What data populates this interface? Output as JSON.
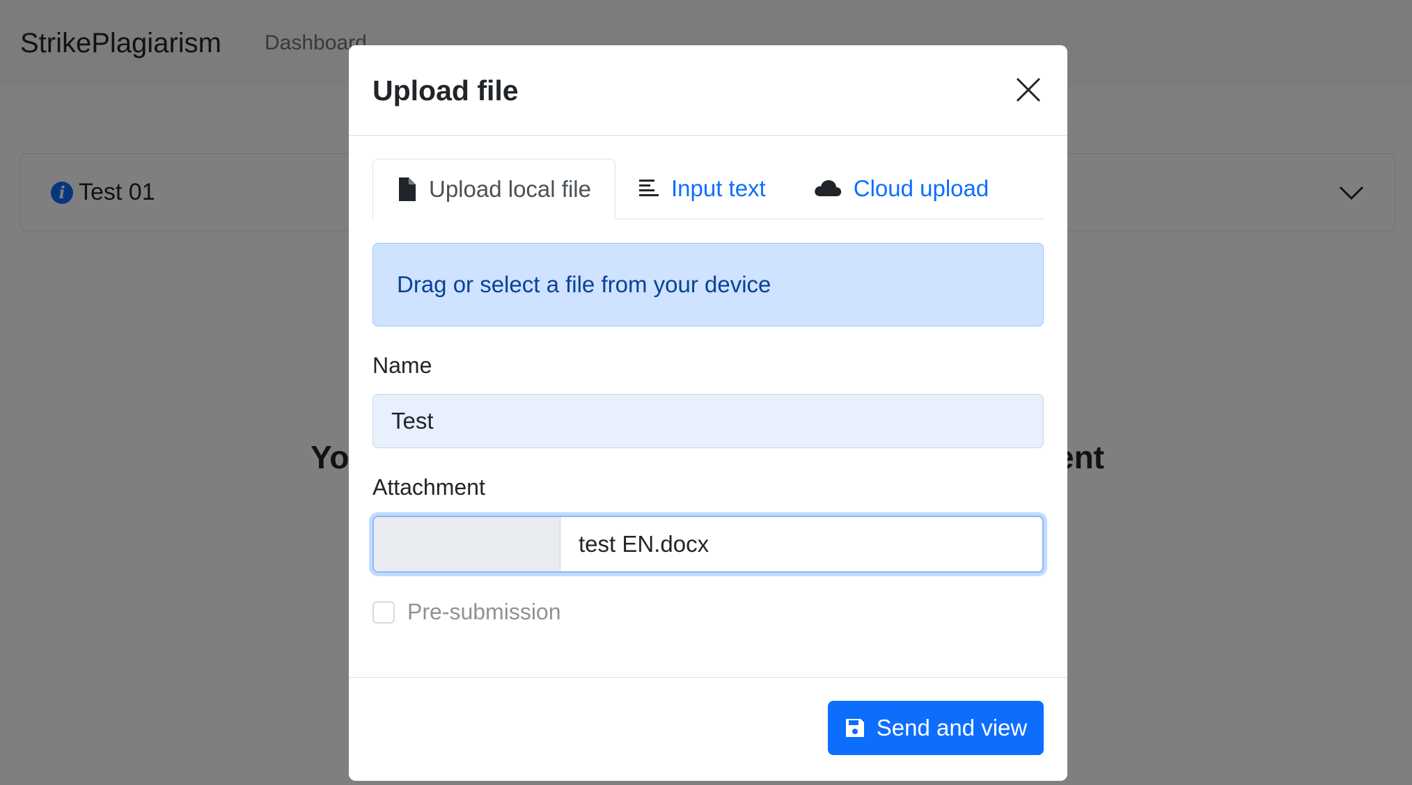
{
  "navbar": {
    "brand": "StrikePlagiarism",
    "link": "Dashboard"
  },
  "card": {
    "title": "Test 01",
    "icon": "info-icon"
  },
  "background": {
    "message_left": "Yo",
    "message_right": "ent"
  },
  "modal": {
    "title": "Upload file",
    "tabs": [
      {
        "label": "Upload local file",
        "icon": "file-icon",
        "active": true
      },
      {
        "label": "Input text",
        "icon": "align-left-icon",
        "active": false
      },
      {
        "label": "Cloud upload",
        "icon": "cloud-icon",
        "active": false
      }
    ],
    "dropzone_text": "Drag or select a file from your device",
    "name_label": "Name",
    "name_value": "Test",
    "attachment_label": "Attachment",
    "attachment_filename": "test EN.docx",
    "presubmission_label": "Pre-submission",
    "presubmission_checked": false,
    "send_button": "Send and view"
  },
  "colors": {
    "primary": "#0d6efd",
    "dropzone_bg": "#cfe2ff",
    "dropzone_text": "#084298",
    "input_autofill_bg": "#e8f0fe"
  }
}
